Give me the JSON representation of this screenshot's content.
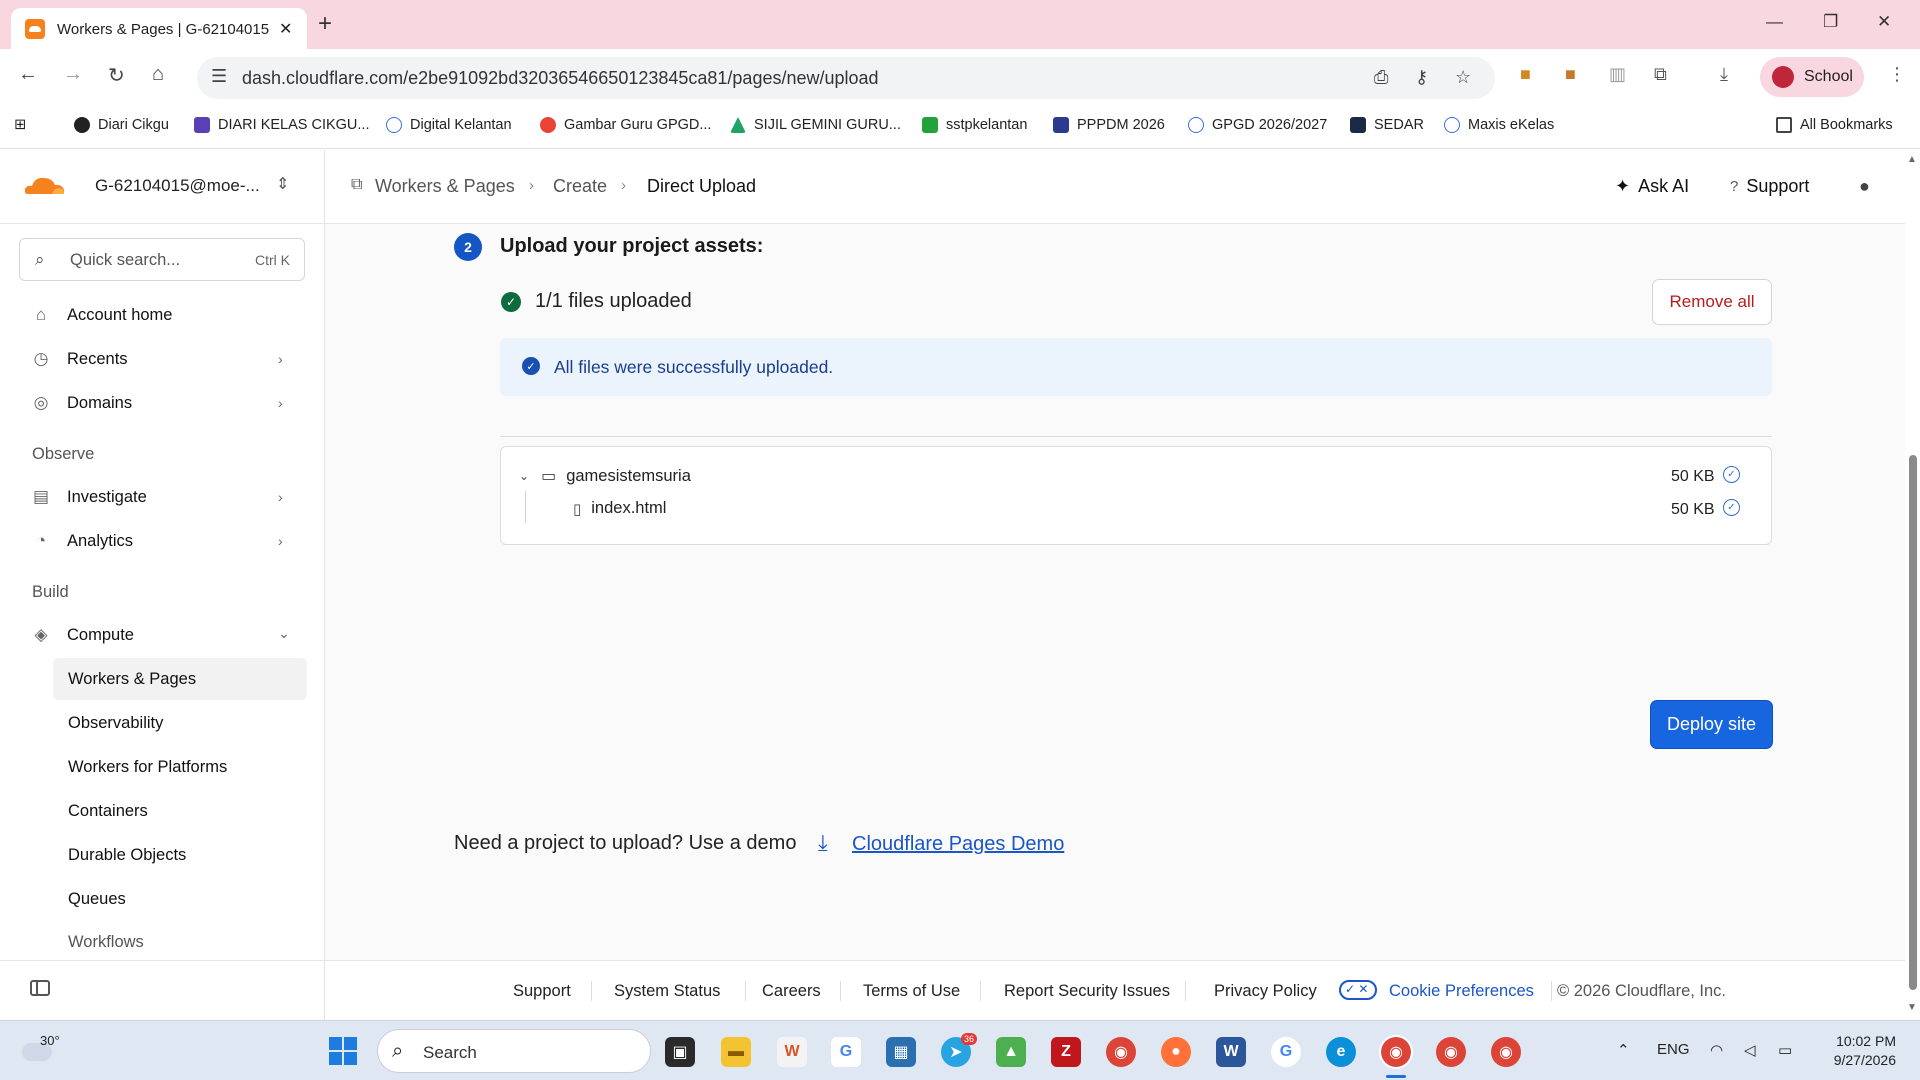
{
  "browser": {
    "tab_title": "Workers & Pages | G-62104015",
    "url": "dash.cloudflare.com/e2be91092bd32036546650123845ca81/pages/new/upload",
    "profile_label": "School",
    "bookmarks": [
      "Diari Cikgu",
      "DIARI KELAS CIKGU...",
      "Digital Kelantan",
      "Gambar Guru GPGD...",
      "SIJIL GEMINI GURU...",
      "sstpkelantan",
      "PPPDM 2026",
      "GPGD 2026/2027",
      "SEDAR",
      "Maxis eKelas"
    ],
    "all_bookmarks": "All Bookmarks"
  },
  "sidebar": {
    "account": "G-62104015@moe-...",
    "search_placeholder": "Quick search...",
    "search_shortcut": "Ctrl K",
    "items": [
      {
        "label": "Account home"
      },
      {
        "label": "Recents"
      },
      {
        "label": "Domains"
      }
    ],
    "observe_header": "Observe",
    "observe_items": [
      {
        "label": "Investigate"
      },
      {
        "label": "Analytics"
      }
    ],
    "build_header": "Build",
    "compute_label": "Compute",
    "compute_items": [
      "Workers & Pages",
      "Observability",
      "Workers for Platforms",
      "Containers",
      "Durable Objects",
      "Queues",
      "Workflows"
    ]
  },
  "header": {
    "breadcrumbs": [
      "Workers & Pages",
      "Create",
      "Direct Upload"
    ],
    "ask_ai": "Ask AI",
    "support": "Support"
  },
  "upload": {
    "step_number": "2",
    "title": "Upload your project assets:",
    "status": "1/1 files uploaded",
    "remove_all": "Remove all",
    "success_message": "All files were successfully uploaded.",
    "files": [
      {
        "name": "gamesistemsuria",
        "size": "50 KB",
        "type": "folder"
      },
      {
        "name": "index.html",
        "size": "50 KB",
        "type": "file"
      }
    ],
    "deploy_label": "Deploy site",
    "demo_prompt": "Need a project to upload? Use a demo",
    "demo_link": "Cloudflare Pages Demo"
  },
  "footer": {
    "links": [
      "Support",
      "System Status",
      "Careers",
      "Terms of Use",
      "Report Security Issues",
      "Privacy Policy"
    ],
    "cookie": "Cookie Preferences",
    "copyright": "© 2026 Cloudflare, Inc."
  },
  "taskbar": {
    "weather": "30°",
    "search": "Search",
    "lang": "ENG",
    "time": "10:02 PM",
    "date": "9/27/2026",
    "badge": "36"
  },
  "colors": {
    "accent": "#1766e0",
    "tab_bar": "#f9d7e0",
    "success": "#0f6b3d",
    "danger": "#b51c1c",
    "cloudflare_orange": "#f6821f"
  }
}
